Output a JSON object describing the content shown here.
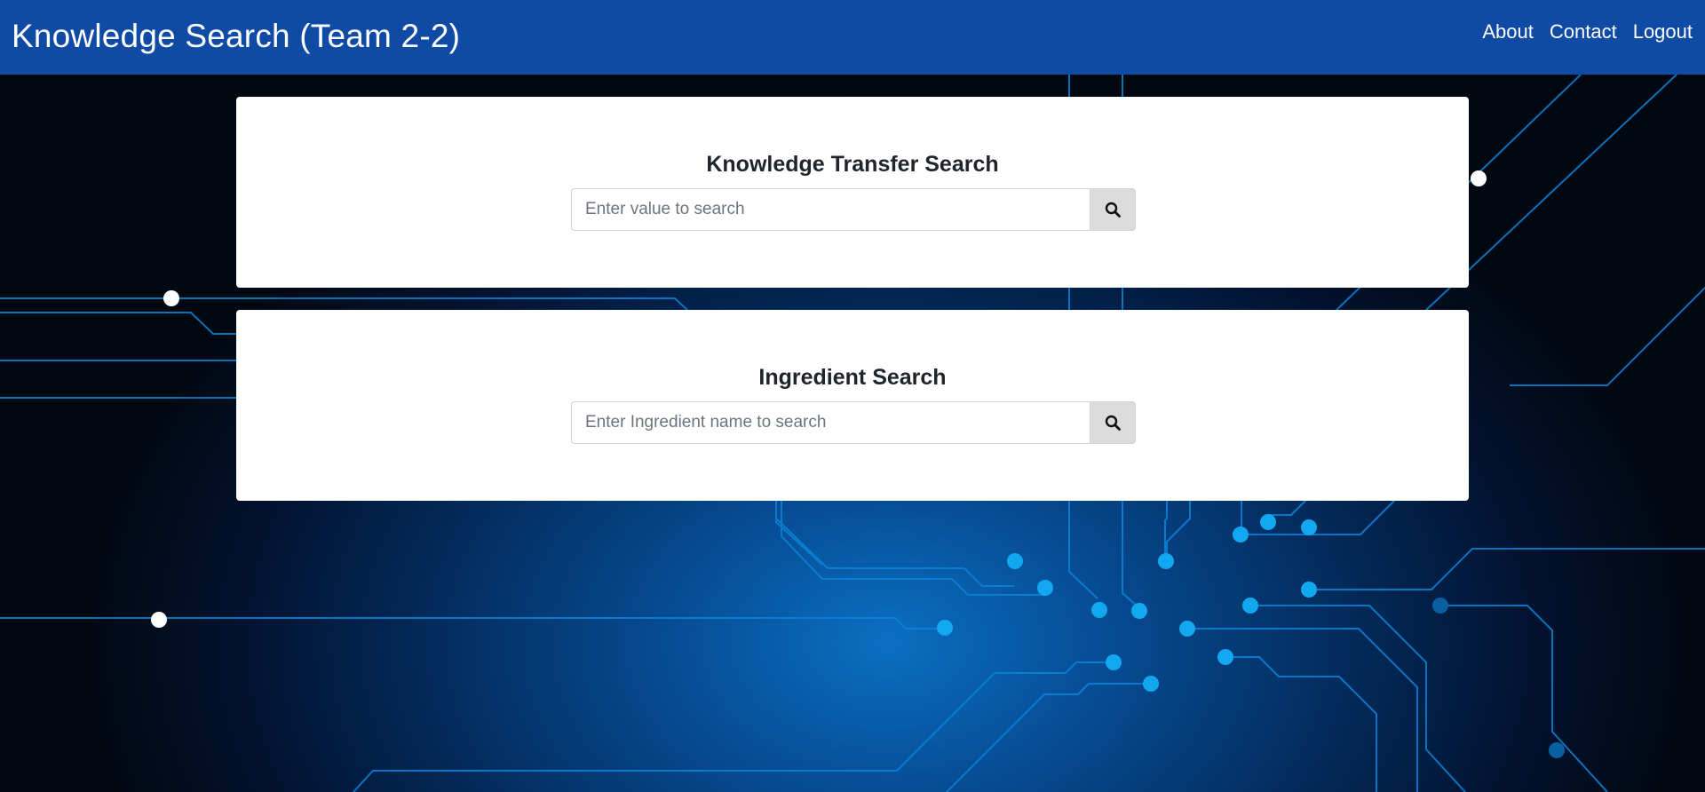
{
  "app": {
    "title": "Knowledge Search (Team 2-2)"
  },
  "nav": {
    "about": "About",
    "contact": "Contact",
    "logout": "Logout"
  },
  "knowledge_search": {
    "title": "Knowledge Transfer Search",
    "placeholder": "Enter value to search",
    "value": "",
    "button_icon": "search-icon"
  },
  "ingredient_search": {
    "title": "Ingredient Search",
    "placeholder": "Enter Ingredient name to search",
    "value": "",
    "button_icon": "search-icon"
  },
  "colors": {
    "navbar": "#0f4aa5",
    "circuit_line": "#0b84d8",
    "circuit_node": "#12a8f0",
    "card": "#ffffff",
    "search_button": "#dcdcdc"
  },
  "background": {
    "style": "blue circuit board"
  }
}
